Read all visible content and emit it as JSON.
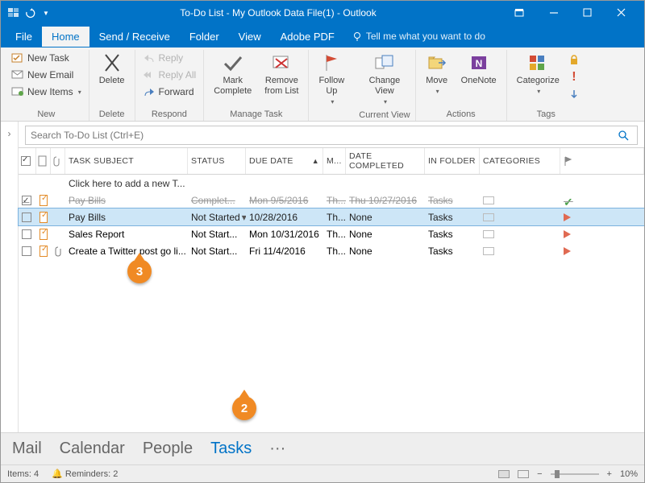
{
  "window": {
    "title": "To-Do List - My Outlook Data File(1) - Outlook"
  },
  "menu": {
    "file": "File",
    "home": "Home",
    "send_receive": "Send / Receive",
    "folder": "Folder",
    "view": "View",
    "adobe_pdf": "Adobe PDF",
    "tell_me": "Tell me what you want to do"
  },
  "ribbon": {
    "new_task": "New Task",
    "new_email": "New Email",
    "new_items": "New Items",
    "new_group": "New",
    "delete": "Delete",
    "delete_group": "Delete",
    "reply": "Reply",
    "reply_all": "Reply All",
    "forward": "Forward",
    "respond_group": "Respond",
    "mark_complete": "Mark\nComplete",
    "remove_list": "Remove\nfrom List",
    "manage_group": "Manage Task",
    "follow_up": "Follow\nUp",
    "change_view": "Change\nView",
    "current_view_group": "Current View",
    "move": "Move",
    "onenote": "OneNote",
    "actions_group": "Actions",
    "categorize": "Categorize",
    "tags_group": "Tags"
  },
  "search": {
    "placeholder": "Search To-Do List (Ctrl+E)"
  },
  "columns": {
    "subject": "Task Subject",
    "status": "Status",
    "due": "Due Date",
    "modified": "M...",
    "completed": "Date Completed",
    "folder": "In Folder",
    "categories": "Categories"
  },
  "add_row": "Click here to add a new T...",
  "rows": [
    {
      "subject": "Pay Bills",
      "status": "Complet...",
      "due": "Mon 9/5/2016",
      "mod": "Th...",
      "completed": "Thu 10/27/2016",
      "folder": "Tasks",
      "done": true,
      "flag": "green",
      "att": false
    },
    {
      "subject": "Pay Bills",
      "status": "Not Started",
      "due": "10/28/2016",
      "mod": "Th...",
      "completed": "None",
      "folder": "Tasks",
      "done": false,
      "flag": "red",
      "att": false,
      "selected": true
    },
    {
      "subject": "Sales Report",
      "status": "Not Start...",
      "due": "Mon 10/31/2016",
      "mod": "Th...",
      "completed": "None",
      "folder": "Tasks",
      "done": false,
      "flag": "red",
      "att": false
    },
    {
      "subject": "Create a Twitter post go li...",
      "status": "Not Start...",
      "due": "Fri 11/4/2016",
      "mod": "Th...",
      "completed": "None",
      "folder": "Tasks",
      "done": false,
      "flag": "red",
      "att": true
    }
  ],
  "nav": {
    "mail": "Mail",
    "calendar": "Calendar",
    "people": "People",
    "tasks": "Tasks",
    "more": "···"
  },
  "status": {
    "items": "Items: 4",
    "reminders": "Reminders: 2",
    "zoom": "10%"
  },
  "callouts": {
    "c2": "2",
    "c3": "3"
  }
}
